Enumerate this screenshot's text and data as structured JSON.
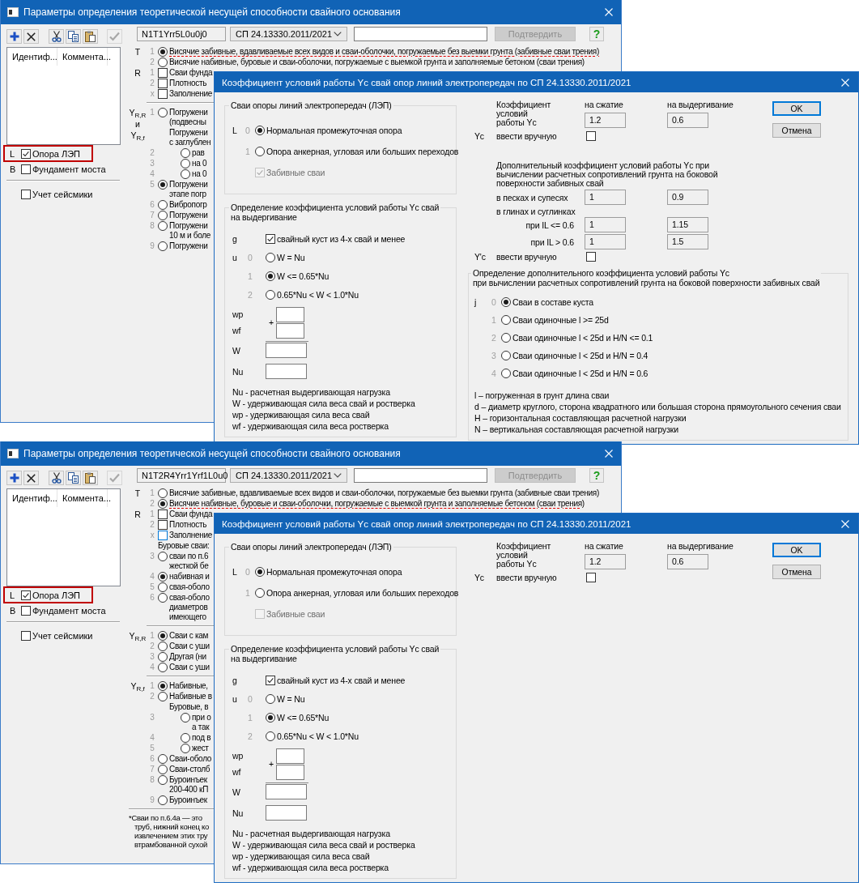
{
  "screenshots": [
    {
      "main": {
        "title": "Параметры определения теоретической несущей способности свайного основания",
        "toolbar": [
          {
            "kind": "add",
            "disabled": false
          },
          {
            "kind": "delete",
            "disabled": false
          },
          {
            "kind": "cut",
            "disabled": false
          },
          {
            "kind": "copy",
            "disabled": false
          },
          {
            "kind": "paste",
            "disabled": false
          },
          {
            "kind": "apply",
            "disabled": true
          }
        ],
        "code": "N1T1Yrr5L0u0j0",
        "norm": "СП 24.13330.2011/2021",
        "confirm": {
          "label": "Подтвердить",
          "disabled": true
        },
        "help": "?",
        "list_columns": [
          "Идентиф...",
          "Коммента..."
        ],
        "options": [
          {
            "letter": "L",
            "label": "Опора ЛЭП",
            "checked": true,
            "highlighted": true
          },
          {
            "letter": "B",
            "label": "Фундамент моста",
            "checked": false,
            "highlighted": false
          }
        ],
        "seismic": {
          "label": "Учет сейсмики",
          "checked": false
        },
        "sections": [
          {
            "labels": [
              "T"
            ],
            "separated": false,
            "rows": [
              {
                "kind": "radio",
                "num": "1",
                "text": "Висячие забивные, вдавливаемые всех видов и сваи-оболочки, погружаемые без выемки грунта (забивные сваи трения)",
                "selected": true,
                "underlined": true
              },
              {
                "kind": "radio",
                "num": "2",
                "text": "Висячие набивные, буровые и сваи-оболочки, погружаемые с выемкой грунта и заполняемые бетоном (сваи трения)",
                "selected": false,
                "underlined": false
              }
            ]
          },
          {
            "labels": [
              "R"
            ],
            "separated": false,
            "rows": [
              {
                "kind": "checkbox",
                "num": "1",
                "text": "Сваи фунда",
                "checked": false,
                "focused": false
              },
              {
                "kind": "checkbox",
                "num": "2",
                "text": "Плотность",
                "checked": false,
                "focused": false
              },
              {
                "kind": "checkbox",
                "num": "x",
                "text": "Заполнение",
                "checked": false,
                "focused": false
              }
            ]
          },
          {
            "labels": [
              "Y$_{R,R}$",
              "и",
              "Y$_{R,f}$"
            ],
            "separated": true,
            "rows": [
              {
                "kind": "radio",
                "num": "1",
                "text": "Погружени\n(подвесны",
                "selected": false
              },
              {
                "kind": "heading",
                "text": "Погружени\nс заглублен",
                "children": [
                  {
                    "num": "2",
                    "text": "рав",
                    "selected": false
                  },
                  {
                    "num": "3",
                    "text": "на 0",
                    "selected": false
                  },
                  {
                    "num": "4",
                    "text": "на 0",
                    "selected": false
                  }
                ]
              },
              {
                "kind": "radio",
                "num": "5",
                "text": "Погружени\nэтапе погр",
                "selected": true
              },
              {
                "kind": "radio",
                "num": "6",
                "text": "Вибропогр",
                "selected": false
              },
              {
                "kind": "radio",
                "num": "7",
                "text": "Погружени",
                "selected": false
              },
              {
                "kind": "radio",
                "num": "8",
                "text": "Погружени\n10 м и боле",
                "selected": false
              },
              {
                "kind": "radio",
                "num": "9",
                "text": "Погружени",
                "selected": false
              }
            ]
          }
        ]
      },
      "dialog": {
        "title": "Коэффициент условий работы Yc свай опор линий электропередач по СП 24.13330.2011/2021",
        "supports": {
          "legend": "Сваи опоры линий электропередач (ЛЭП)",
          "letter": "L",
          "options": [
            {
              "num": "0",
              "label": "Нормальная промежуточная опора",
              "selected": true
            },
            {
              "num": "1",
              "label": "Опора анкерная, угловая или больших переходов",
              "selected": false
            }
          ],
          "driven": {
            "label": "Забивные сваи",
            "checked": true,
            "disabled": true
          }
        },
        "pullout": {
          "legend": "Определение коэффициента условий работы Yc свай\nна выдергивание",
          "group": {
            "letter": "g",
            "label": "свайный куст из 4-х свай и менее",
            "checked": true
          },
          "letter": "u",
          "options": [
            {
              "num": "0",
              "label": "W = Nu",
              "selected": false
            },
            {
              "num": "1",
              "label": "W <= 0.65*Nu",
              "selected": true
            },
            {
              "num": "2",
              "label": "0.65*Nu < W < 1.0*Nu",
              "selected": false
            }
          ],
          "weights": [
            "wp",
            "wf"
          ],
          "plus": "+",
          "total": "W",
          "load": "Nu",
          "notes": [
            "Nu - расчетная выдергивающая нагрузка",
            "W - удерживающая сила веса свай и ростверка",
            "wp - удерживающая сила веса свай",
            "wf - удерживающая сила веса ростверка"
          ]
        },
        "coefficient": {
          "label": "Коэффициент\nусловий\nработы Yc",
          "columns": [
            "на сжатие",
            "на выдергивание"
          ],
          "values": [
            "1.2",
            "0.6"
          ],
          "symbol": "Yc",
          "manual": {
            "label": "ввести вручную",
            "checked": false
          }
        },
        "buttons": [
          {
            "label": "OK",
            "default": true
          },
          {
            "label": "Отмена",
            "default": false
          }
        ],
        "additional": {
          "text": "Дополнительный коэффициент условий работы Yc при\nвычислении расчетных сопротивлений грунта на боковой\nповерхности забивных свай",
          "rows": [
            {
              "kind": "values",
              "label": "в песках и супесях",
              "values": [
                "1",
                "0.9"
              ]
            },
            {
              "kind": "heading",
              "label": "в глинах и суглинках"
            },
            {
              "kind": "subvalues",
              "label": "при IL <= 0.6",
              "values": [
                "1",
                "1.15"
              ]
            },
            {
              "kind": "subvalues",
              "label": "при IL > 0.6",
              "values": [
                "1",
                "1.5"
              ]
            }
          ],
          "symbol": "Y'c",
          "manual": {
            "label": "ввести вручную",
            "checked": false
          }
        },
        "lateral": {
          "legend": "Определение дополнительного коэффициента условий работы Yc\nпри вычислении расчетных сопротивлений грунта на боковой поверхности забивных свай",
          "letter": "j",
          "options": [
            {
              "num": "0",
              "label": "Сваи в составе куста",
              "selected": true
            },
            {
              "num": "1",
              "label": "Сваи одиночные l >= 25d",
              "selected": false
            },
            {
              "num": "2",
              "label": "Сваи одиночные l < 25d и H/N <= 0.1",
              "selected": false
            },
            {
              "num": "3",
              "label": "Сваи одиночные l < 25d и H/N = 0.4",
              "selected": false
            },
            {
              "num": "4",
              "label": "Сваи одиночные l < 25d и H/N = 0.6",
              "selected": false
            }
          ],
          "notes": [
            "l – погруженная в грунт длина сваи",
            "d – диаметр круглого, сторона квадратного или большая сторона прямоугольного сечения сваи",
            "H – горизонтальная составляющая расчетной нагрузки",
            "N – вертикальная составляющая расчетной нагрузки"
          ]
        }
      }
    },
    {
      "main": {
        "title": "Параметры определения теоретической несущей способности свайного основания",
        "toolbar": [
          {
            "kind": "add",
            "disabled": false
          },
          {
            "kind": "delete",
            "disabled": false
          },
          {
            "kind": "cut",
            "disabled": false
          },
          {
            "kind": "copy",
            "disabled": false
          },
          {
            "kind": "paste",
            "disabled": false
          },
          {
            "kind": "apply",
            "disabled": true
          }
        ],
        "code": "N1T2R4Yrr1Yrf1L0u0",
        "norm": "СП 24.13330.2011/2021",
        "confirm": {
          "label": "Подтвердить",
          "disabled": true
        },
        "help": "?",
        "list_columns": [
          "Идентиф...",
          "Коммента..."
        ],
        "options": [
          {
            "letter": "L",
            "label": "Опора ЛЭП",
            "checked": true,
            "highlighted": true
          },
          {
            "letter": "B",
            "label": "Фундамент моста",
            "checked": false,
            "highlighted": false
          }
        ],
        "seismic": {
          "label": "Учет сейсмики",
          "checked": false
        },
        "sections": [
          {
            "labels": [
              "T"
            ],
            "separated": false,
            "rows": [
              {
                "kind": "radio",
                "num": "1",
                "text": "Висячие забивные, вдавливаемые всех видов и сваи-оболочки, погружаемые без выемки грунта (забивные сваи трения)",
                "selected": false,
                "underlined": false
              },
              {
                "kind": "radio",
                "num": "2",
                "text": "Висячие набивные, буровые и сваи-оболочки, погружаемые с выемкой грунта и заполняемые бетоном (сваи трения)",
                "selected": true,
                "underlined": true
              }
            ]
          },
          {
            "labels": [
              "R"
            ],
            "separated": false,
            "rows": [
              {
                "kind": "checkbox",
                "num": "1",
                "text": "Сваи фунда",
                "checked": false,
                "focused": false
              },
              {
                "kind": "checkbox",
                "num": "2",
                "text": "Плотность",
                "checked": false,
                "focused": false
              },
              {
                "kind": "checkbox",
                "num": "x",
                "text": "Заполнение",
                "checked": false,
                "focused": true
              },
              {
                "kind": "text",
                "text": "Буровые сваи:"
              },
              {
                "kind": "radio",
                "num": "3",
                "text": "сваи по п.6\nжесткой бе",
                "selected": false
              },
              {
                "kind": "radio",
                "num": "4",
                "text": "набивная и",
                "selected": true
              },
              {
                "kind": "radio",
                "num": "5",
                "text": "свая-оболо",
                "selected": false
              },
              {
                "kind": "radio",
                "num": "6",
                "text": "свая-оболо\nдиаметров\nимеющего",
                "selected": false
              }
            ]
          },
          {
            "labels": [
              "Y$_{R,R}$"
            ],
            "separated": true,
            "rows": [
              {
                "kind": "radio",
                "num": "1",
                "text": "Сваи с кам",
                "selected": true
              },
              {
                "kind": "radio",
                "num": "2",
                "text": "Сваи с уши",
                "selected": false
              },
              {
                "kind": "radio",
                "num": "3",
                "text": "Другая (ни",
                "selected": false
              },
              {
                "kind": "radio",
                "num": "4",
                "text": "Сваи с уши",
                "selected": false
              }
            ]
          },
          {
            "labels": [
              "Y$_{R,f}$"
            ],
            "separated": true,
            "rows": [
              {
                "kind": "radio",
                "num": "1",
                "text": "Набивные,",
                "selected": true
              },
              {
                "kind": "radio",
                "num": "2",
                "text": "Набивные в",
                "selected": false
              },
              {
                "kind": "heading",
                "text": "Буровые, в",
                "children": [
                  {
                    "num": "3",
                    "text": "при о\nа так",
                    "selected": false
                  },
                  {
                    "num": "4",
                    "text": "под в",
                    "selected": false
                  },
                  {
                    "num": "5",
                    "text": "жест",
                    "selected": false
                  }
                ]
              },
              {
                "kind": "radio",
                "num": "6",
                "text": "Сваи-оболо",
                "selected": false
              },
              {
                "kind": "radio",
                "num": "7",
                "text": "Сваи-столб",
                "selected": false
              },
              {
                "kind": "radio",
                "num": "8",
                "text": "Буроинъек\n200-400 кП",
                "selected": false
              },
              {
                "kind": "radio",
                "num": "9",
                "text": "Буроинъек",
                "selected": false
              }
            ]
          }
        ],
        "footnote": "*Сваи по п.6.4а — это\nтруб, нижний конец ко\nизвлечением этих тру\nвтрамбованной сухой"
      },
      "dialog": {
        "title": "Коэффициент условий работы Yc свай опор линий электропередач по СП 24.13330.2011/2021",
        "supports": {
          "legend": "Сваи опоры линий электропередач (ЛЭП)",
          "letter": "L",
          "options": [
            {
              "num": "0",
              "label": "Нормальная промежуточная опора",
              "selected": true
            },
            {
              "num": "1",
              "label": "Опора анкерная, угловая или больших переходов",
              "selected": false
            }
          ],
          "driven": {
            "label": "Забивные сваи",
            "checked": false,
            "disabled": true
          }
        },
        "pullout": {
          "legend": "Определение коэффициента условий работы Yc свай\nна выдергивание",
          "group": {
            "letter": "g",
            "label": "свайный куст из 4-х свай и менее",
            "checked": true
          },
          "letter": "u",
          "options": [
            {
              "num": "0",
              "label": "W = Nu",
              "selected": false
            },
            {
              "num": "1",
              "label": "W <= 0.65*Nu",
              "selected": true
            },
            {
              "num": "2",
              "label": "0.65*Nu < W < 1.0*Nu",
              "selected": false
            }
          ],
          "weights": [
            "wp",
            "wf"
          ],
          "plus": "+",
          "total": "W",
          "load": "Nu",
          "notes": [
            "Nu - расчетная выдергивающая нагрузка",
            "W - удерживающая сила веса свай и ростверка",
            "wp - удерживающая сила веса свай",
            "wf - удерживающая сила веса ростверка"
          ]
        },
        "coefficient": {
          "label": "Коэффициент\nусловий\nработы Yc",
          "columns": [
            "на сжатие",
            "на выдергивание"
          ],
          "values": [
            "1.2",
            "0.6"
          ],
          "symbol": "Yc",
          "manual": {
            "label": "ввести вручную",
            "checked": false
          }
        },
        "buttons": [
          {
            "label": "OK",
            "default": true
          },
          {
            "label": "Отмена",
            "default": false
          }
        ]
      }
    }
  ]
}
